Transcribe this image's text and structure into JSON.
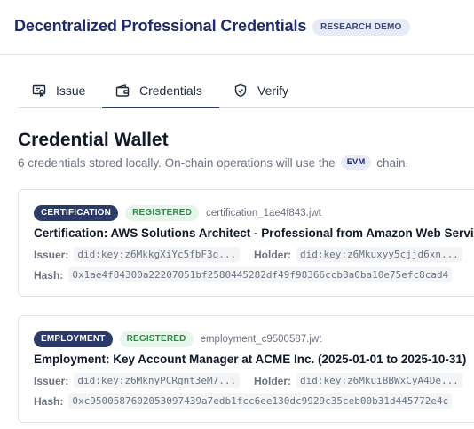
{
  "header": {
    "title": "Decentralized Professional Credentials",
    "badge": "RESEARCH DEMO"
  },
  "tabs": [
    {
      "label": "Issue",
      "icon": "certificate-icon"
    },
    {
      "label": "Credentials",
      "icon": "wallet-icon",
      "active": true
    },
    {
      "label": "Verify",
      "icon": "shield-icon"
    }
  ],
  "wallet": {
    "title": "Credential Wallet",
    "subtitle_pre": "6 credentials stored locally. On-chain operations will use the",
    "chain": "EVM",
    "subtitle_post": "chain."
  },
  "labels": {
    "issuer": "Issuer:",
    "holder": "Holder:",
    "hash": "Hash:"
  },
  "credentials": [
    {
      "type": "CERTIFICATION",
      "status": "REGISTERED",
      "file": "certification_1ae4f843.jwt",
      "title": "Certification: AWS Solutions Architect - Professional from Amazon Web Services",
      "issuer": "did:key:z6MkkgXiYc5fbF3q...",
      "holder": "did:key:z6Mkuxyy5cjjd6xn...",
      "hash": "0x1ae4f84300a22207051bf2580445282df49f98366ccb8a0ba10e75efc8cad4"
    },
    {
      "type": "EMPLOYMENT",
      "status": "REGISTERED",
      "file": "employment_c9500587.jwt",
      "title": "Employment: Key Account Manager at ACME Inc. (2025-01-01 to 2025-10-31)",
      "issuer": "did:key:z6MknyPCRgnt3eM7...",
      "holder": "did:key:z6MkuiBBWxCyA4De...",
      "hash": "0xc9500587602053097439a7edb1fcc6ee130dc9929c35ceb00b31d445772e4c"
    }
  ],
  "colors": {
    "brand": "#1e2a6b",
    "type_badge": "#2b3a67",
    "registered_bg": "#e6f6ea",
    "registered_text": "#2e8b45"
  }
}
